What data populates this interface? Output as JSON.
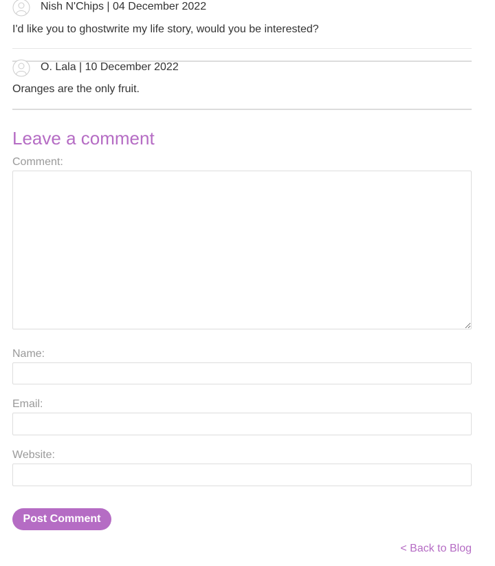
{
  "comments": [
    {
      "author": "Nish N'Chips",
      "date": "04 December 2022",
      "meta": "Nish N'Chips | 04 December 2022",
      "text": "I'd like you to ghostwrite my life story, would you be interested?",
      "avatar_icon": "user-avatar-icon"
    },
    {
      "author": "O. Lala",
      "date": "10 December 2022",
      "meta": "O. Lala | 10 December 2022",
      "text": "Oranges are the only fruit.",
      "avatar_icon": "user-avatar-icon"
    }
  ],
  "form": {
    "title": "Leave a comment",
    "comment_label": "Comment:",
    "comment_value": "",
    "name_label": "Name:",
    "name_value": "",
    "email_label": "Email:",
    "email_value": "",
    "website_label": "Website:",
    "website_value": "",
    "submit_label": "Post Comment"
  },
  "footer": {
    "back_link": "< Back to Blog"
  },
  "colors": {
    "accent": "#b56cc4",
    "label": "#999999",
    "text": "#333333",
    "border": "#dddddd"
  }
}
